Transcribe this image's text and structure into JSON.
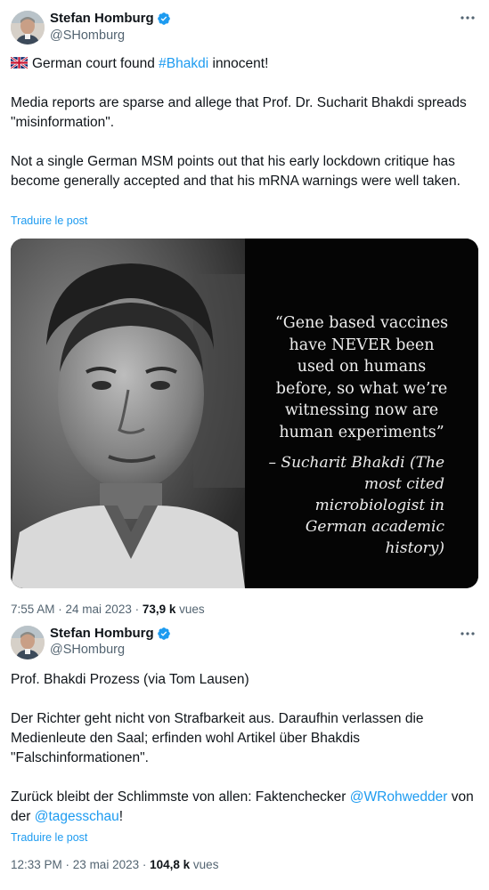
{
  "tweet1": {
    "author_name": "Stefan Homburg",
    "handle": "@SHomburg",
    "flag_icon": "uk-flag-icon",
    "line1_pre": "German court found ",
    "line1_hashtag": "#Bhakdi",
    "line1_post": " innocent!",
    "para2": "Media reports are sparse and allege that Prof. Dr. Sucharit Bhakdi spreads \"misinformation\".",
    "para3": "Not a single German MSM points out that his early lockdown critique has become generally accepted and that his mRNA warnings were well taken.",
    "translate": "Traduire le post",
    "media": {
      "quote": "“Gene based vaccines have NEVER been used on humans before, so what we’re witnessing now are human experiments”",
      "attribution": "– Sucharit Bhakdi (The most cited microbiologist in German academic history)"
    },
    "time": "7:55 AM",
    "date": "24 mai 2023",
    "views_count": "73,9 k",
    "views_label": "vues"
  },
  "tweet2": {
    "author_name": "Stefan Homburg",
    "handle": "@SHomburg",
    "para1": "Prof. Bhakdi Prozess (via Tom Lausen)",
    "para2": "Der Richter geht nicht von Strafbarkeit aus. Daraufhin verlassen die Medienleute den Saal; erfinden wohl Artikel über Bhakdis \"Falschinformationen\".",
    "para3_pre": "Zurück bleibt der Schlimmste von allen: Faktenchecker ",
    "mention1": "@WRohwedder",
    "para3_mid": " von der ",
    "mention2": "@tagesschau",
    "para3_post": "!",
    "translate": "Traduire le post",
    "time": "12:33 PM",
    "date": "23 mai 2023",
    "views_count": "104,8 k",
    "views_label": "vues"
  },
  "colors": {
    "link": "#1d9bf0",
    "secondary": "#536471",
    "text": "#0f1419"
  }
}
